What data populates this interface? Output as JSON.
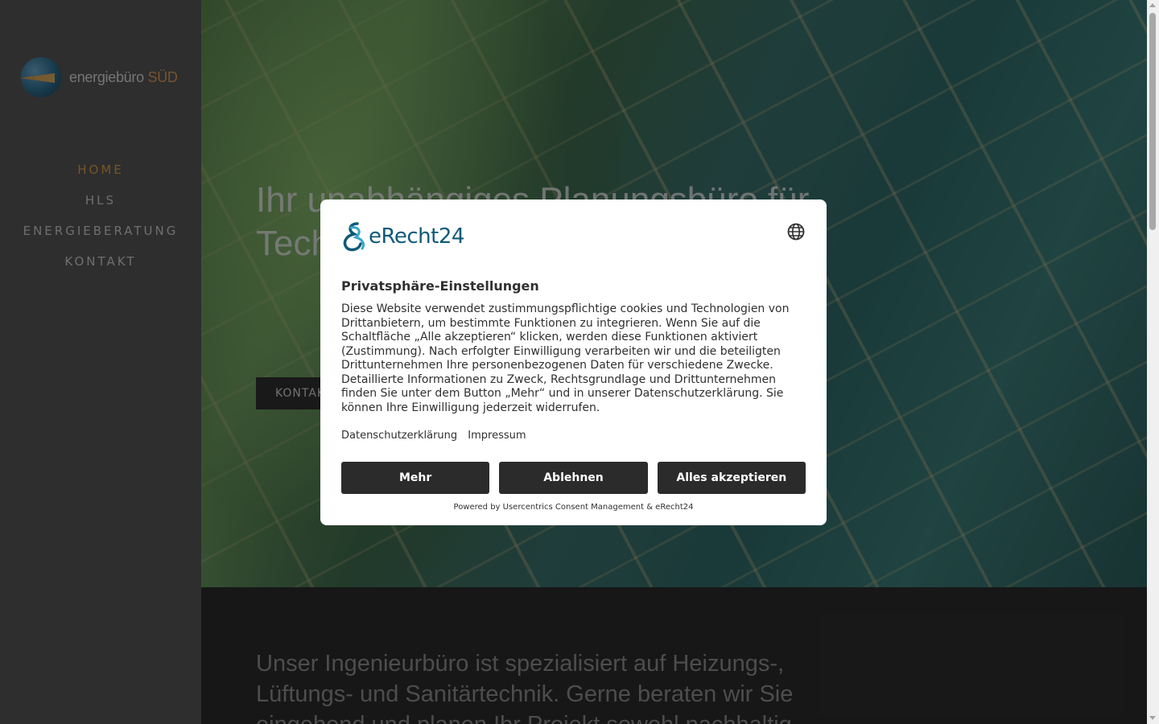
{
  "sidebar": {
    "logo": {
      "main": "energiebüro",
      "accent": "SÜD"
    },
    "nav": [
      {
        "label": "HOME",
        "active": true
      },
      {
        "label": "HLS",
        "active": false
      },
      {
        "label": "ENERGIEBERATUNG",
        "active": false
      },
      {
        "label": "KONTAKT",
        "active": false
      }
    ]
  },
  "hero": {
    "title": "Ihr unabhängiges Planungsbüro für Technik HEIZ",
    "button_label": "KONTAKT"
  },
  "intro": {
    "text": "Unser Ingenieurbüro ist spezialisiert auf Heizungs-, Lüftungs- und Sanitärtechnik. Gerne beraten wir Sie eingehend und planen Ihr Projekt sowohl nachhaltig"
  },
  "consent": {
    "brand": "eRecht24",
    "title": "Privatsphäre-Einstellungen",
    "body": "Diese Website verwendet zustimmungspflichtige cookies und Technologien von Drittanbietern, um bestimmte Funktionen zu integrieren. Wenn Sie auf die Schaltfläche „Alle akzeptieren“ klicken, werden diese Funktionen aktiviert (Zustimmung). Nach erfolgter Einwilligung verarbeiten wir und die beteiligten Drittunternehmen Ihre personenbezogenen Daten für verschiedene Zwecke. Detaillierte Informationen zu Zweck, Rechtsgrundlage und Drittunternehmen finden Sie unter dem Button „Mehr“ und in unserer Datenschutzerklärung. Sie können Ihre Einwilligung jederzeit widerrufen.",
    "links": {
      "privacy": "Datenschutzerklärung",
      "imprint": "Impressum"
    },
    "buttons": {
      "more": "Mehr",
      "decline": "Ablehnen",
      "accept_all": "Alles akzeptieren"
    },
    "powered_by": "Powered by Usercentrics Consent Management & eRecht24"
  },
  "colors": {
    "nav_active": "#d89a4a",
    "dialog_button": "#2b2b2b",
    "brand_blue": "#0f5a78"
  }
}
